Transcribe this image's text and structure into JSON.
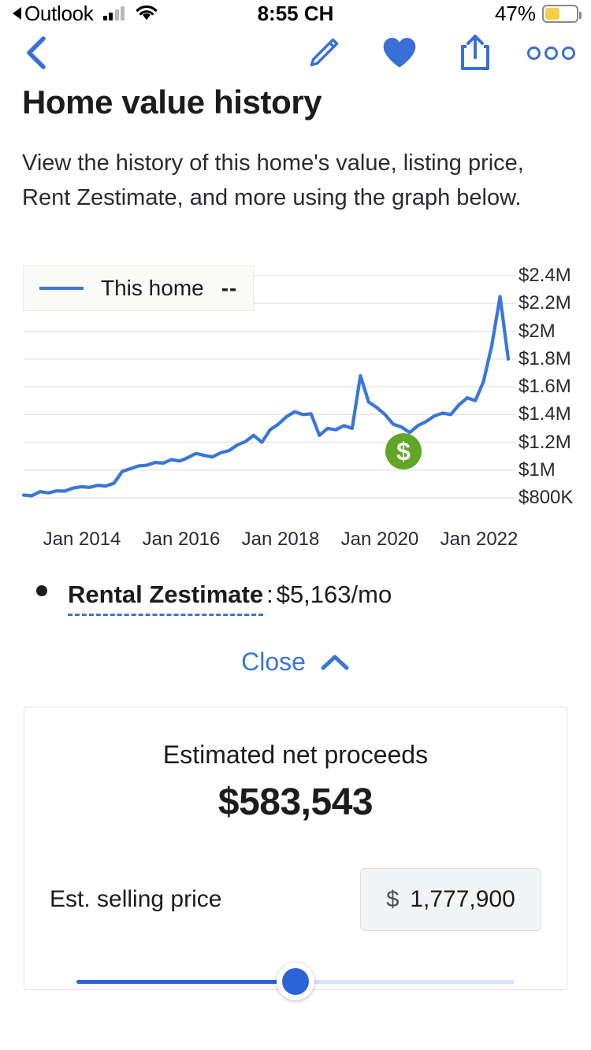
{
  "status_bar": {
    "carrier_back_label": "Outlook",
    "time": "8:55 CH",
    "battery_percent": "47%",
    "signal_icon": "signal-bars-icon",
    "wifi_icon": "wifi-icon",
    "battery_icon": "battery-icon"
  },
  "nav_bar": {
    "back_icon": "chevron-left-icon",
    "edit_icon": "pencil-icon",
    "favorite_icon": "heart-filled-icon",
    "share_icon": "share-icon",
    "more_icon": "more-options-icon"
  },
  "header": {
    "title": "Home value history",
    "description": "View the history of this home's value, listing price, Rent Zestimate, and more using the graph below."
  },
  "chart_data": {
    "type": "line",
    "title": "Home value history",
    "xlabel": "",
    "ylabel": "",
    "grid": true,
    "legend_position": "top-left",
    "legend": [
      {
        "name": "This home",
        "value": "--",
        "color": "#3a76d8"
      }
    ],
    "ytick_labels": [
      "$2.4M",
      "$2.2M",
      "$2M",
      "$1.8M",
      "$1.6M",
      "$1.4M",
      "$1.2M",
      "$1M",
      "$800K"
    ],
    "ytick_values": [
      2400000,
      2200000,
      2000000,
      1800000,
      1600000,
      1400000,
      1200000,
      1000000,
      800000
    ],
    "ylim": [
      750000,
      2450000
    ],
    "xtick_labels": [
      "Jan 2014",
      "Jan 2016",
      "Jan 2018",
      "Jan 2020",
      "Jan 2022"
    ],
    "xlim": [
      "Jan 2013",
      "Jan 2023"
    ],
    "annotations": [
      {
        "type": "marker",
        "icon": "dollar-badge-icon",
        "color": "#63a626",
        "x": "2020-02",
        "y": 1270000,
        "label": "sold/price event"
      }
    ],
    "series": [
      {
        "name": "This home",
        "color": "#3a76d8",
        "x": [
          "2013-03",
          "2013-05",
          "2013-07",
          "2013-09",
          "2013-11",
          "2014-01",
          "2014-03",
          "2014-05",
          "2014-07",
          "2014-09",
          "2014-11",
          "2015-01",
          "2015-03",
          "2015-05",
          "2015-07",
          "2015-09",
          "2015-11",
          "2016-01",
          "2016-03",
          "2016-05",
          "2016-07",
          "2016-09",
          "2016-11",
          "2017-01",
          "2017-03",
          "2017-05",
          "2017-07",
          "2017-09",
          "2017-11",
          "2018-01",
          "2018-03",
          "2018-05",
          "2018-07",
          "2018-09",
          "2018-11",
          "2019-01",
          "2019-03",
          "2019-05",
          "2019-07",
          "2019-09",
          "2019-11",
          "2020-01",
          "2020-03",
          "2020-05",
          "2020-07",
          "2020-09",
          "2020-11",
          "2021-01",
          "2021-03",
          "2021-05",
          "2021-07",
          "2021-09",
          "2021-11",
          "2022-01",
          "2022-03",
          "2022-05",
          "2022-07",
          "2022-09",
          "2022-11",
          "2023-01"
        ],
        "y": [
          820000,
          815000,
          845000,
          835000,
          850000,
          848000,
          870000,
          880000,
          875000,
          890000,
          885000,
          905000,
          990000,
          1010000,
          1030000,
          1035000,
          1055000,
          1050000,
          1075000,
          1065000,
          1090000,
          1120000,
          1105000,
          1095000,
          1125000,
          1140000,
          1180000,
          1205000,
          1250000,
          1200000,
          1290000,
          1330000,
          1385000,
          1420000,
          1400000,
          1405000,
          1250000,
          1300000,
          1290000,
          1320000,
          1300000,
          1680000,
          1490000,
          1450000,
          1400000,
          1330000,
          1310000,
          1270000,
          1320000,
          1350000,
          1390000,
          1410000,
          1400000,
          1470000,
          1520000,
          1500000,
          1640000,
          1900000,
          2250000,
          1800000
        ]
      }
    ]
  },
  "rental": {
    "term": "Rental Zestimate",
    "separator": ":",
    "value": "$5,163/mo"
  },
  "close_control": {
    "label": "Close",
    "icon": "chevron-up-icon"
  },
  "proceeds_card": {
    "title": "Estimated net proceeds",
    "amount": "$583,543",
    "price_label": "Est. selling price",
    "currency_symbol": "$",
    "price_value": "1,777,900",
    "slider": {
      "fill_percent": 50,
      "icon": "slider-thumb"
    }
  },
  "colors": {
    "accent_blue": "#3a76d8",
    "chart_line": "#3a76d8",
    "badge_green": "#63a626",
    "slider_fill": "#2a64d8",
    "slider_track": "#d6e3fb",
    "battery_yellow": "#f7ce46"
  }
}
